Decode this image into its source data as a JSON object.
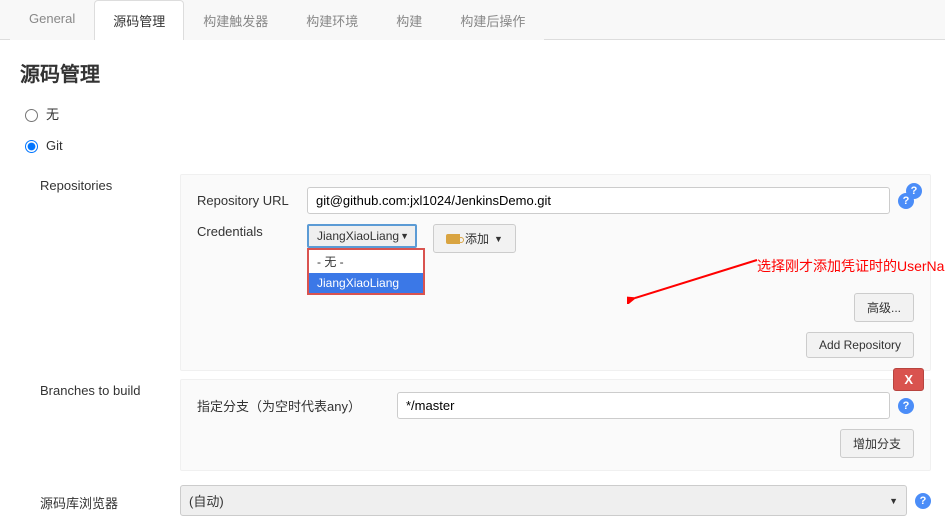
{
  "tabs": [
    "General",
    "源码管理",
    "构建触发器",
    "构建环境",
    "构建",
    "构建后操作"
  ],
  "active_tab_index": 1,
  "section_title": "源码管理",
  "radio_none": "无",
  "radio_git": "Git",
  "repositories": {
    "label": "Repositories",
    "url_label": "Repository URL",
    "url_value": "git@github.com:jxl1024/JenkinsDemo.git",
    "cred_label": "Credentials",
    "cred_selected": "JiangXiaoLiang",
    "cred_options": [
      "- 无 -",
      "JiangXiaoLiang"
    ],
    "add_btn": "添加",
    "advanced_btn": "高级...",
    "add_repo_btn": "Add Repository"
  },
  "branches": {
    "label": "Branches to build",
    "specifier_label": "指定分支（为空时代表any）",
    "specifier_value": "*/master",
    "add_branch_btn": "增加分支",
    "delete_badge": "X"
  },
  "browser": {
    "label": "源码库浏览器",
    "value": "(自动)"
  },
  "annotation_text": "选择刚才添加凭证时的UserName",
  "help_glyph": "?"
}
